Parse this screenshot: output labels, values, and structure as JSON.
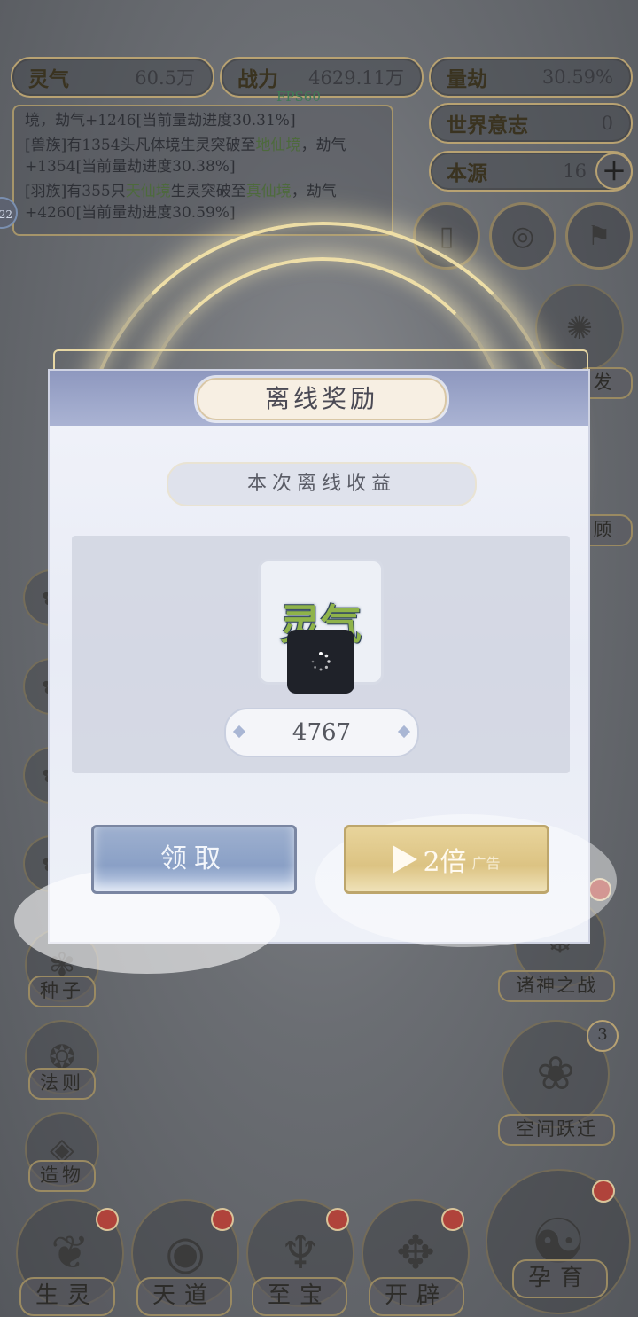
{
  "hud": {
    "stats_left": [
      {
        "label": "灵气",
        "value": "60.5万"
      },
      {
        "label": "战力",
        "value": "4629.11万"
      }
    ],
    "stats_right": [
      {
        "label": "量劫",
        "value": "30.59%"
      },
      {
        "label": "世界意志",
        "value": "0"
      },
      {
        "label": "本源",
        "value": "16"
      }
    ],
    "fps": "FPS60",
    "log": {
      "line1_a": "境，劫气+1246[当前量劫进度30.31%]",
      "line2_a": "[兽族]有1354头凡体境生灵突破至",
      "line2_hl": "地仙境",
      "line2_b": "，劫气+1354[当前量劫进度30.38%]",
      "line3_a": "[羽族]有355只",
      "line3_hl": "天仙境",
      "line3_b": "生灵突破至",
      "line3_hl2": "真仙境",
      "line3_c": "，劫气+4260[当前量劫进度30.59%]"
    },
    "left_edge_badge": "22",
    "plus_icon": "plus-icon"
  },
  "side_right": {
    "labels": [
      "发",
      "顾",
      "诸神之战",
      "空间跃迁"
    ],
    "jump_badge": "3"
  },
  "side_left": {
    "labels": [
      "种子",
      "法则",
      "造物"
    ]
  },
  "bottom_nav": [
    "生灵",
    "天道",
    "至宝",
    "开辟",
    "孕育"
  ],
  "modal": {
    "title": "离线奖励",
    "subtitle": "本次离线收益",
    "item_name": "灵气",
    "quantity": "4767",
    "claim_label": "领取",
    "double_label": "2倍",
    "double_ad_tag": "广告"
  },
  "colors": {
    "gold": "#b8a272",
    "modal_header": "#8e98bf",
    "claim_button": "#8aa0c6",
    "double_button": "#dcc383",
    "item_green": "#8fb34a"
  }
}
